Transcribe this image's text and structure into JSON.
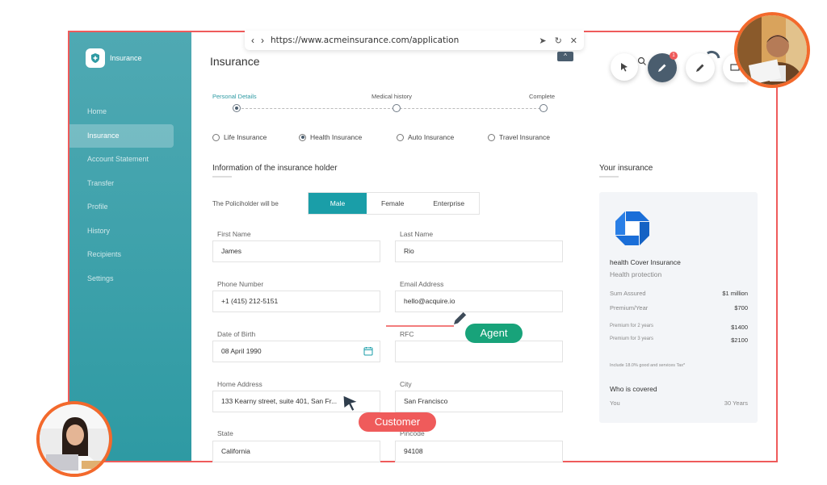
{
  "browser": {
    "back": "‹",
    "forward": "›",
    "url": "https://www.acmeinsurance.com/application",
    "actions": [
      "➤",
      "↻",
      "✕"
    ]
  },
  "sidebar": {
    "brand": "Insurance",
    "items": [
      "Home",
      "Insurance",
      "Account Statement",
      "Transfer",
      "Profile",
      "History",
      "Recipients",
      "Settings"
    ],
    "active_index": 1
  },
  "page": {
    "title": "Insurance",
    "collapse_icon": "^"
  },
  "stepper": {
    "steps": [
      "Personal Details",
      "Medical history",
      "Complete"
    ],
    "active_index": 0
  },
  "insurance_types": {
    "options": [
      "Life Insurance",
      "Health Insurance",
      "Auto Insurance",
      "Travel Insurance"
    ],
    "selected_index": 1
  },
  "holder": {
    "section_title": "Information of the insurance holder",
    "policyholder_label": "The Policiholder will be",
    "options": [
      "Male",
      "Female",
      "Enterprise"
    ],
    "selected_index": 0
  },
  "form": {
    "first_name": {
      "label": "First Name",
      "value": "James"
    },
    "last_name": {
      "label": "Last Name",
      "value": "Rio"
    },
    "phone": {
      "label": "Phone Number",
      "value": "+1 (415) 212-5151"
    },
    "email": {
      "label": "Email Address",
      "value": "hello@acquire.io"
    },
    "dob": {
      "label": "Date of Birth",
      "value": "08  April  1990"
    },
    "rfc": {
      "label": "RFC",
      "value": ""
    },
    "address": {
      "label": "Home Address",
      "value": "133 Kearny street, suite 401, San Fr..."
    },
    "city": {
      "label": "City",
      "value": "San Francisco"
    },
    "state": {
      "label": "State",
      "value": "California"
    },
    "pincode": {
      "label": "Pincode",
      "value": "94108"
    }
  },
  "your_insurance": {
    "section_title": "Your insurance",
    "plan_title": "health Cover Insurance",
    "plan_subtitle": "Health protection",
    "sum_assured_label": "Sum Assured",
    "sum_assured": "$1 million",
    "premium_label": "Premium/Year",
    "premium": "$700",
    "premium2_label": "Premium for 2 years",
    "premium2": "$1400",
    "premium3_label": "Premium for 3 years",
    "premium3": "$2100",
    "tax_note": "Include 18.0% good and services Tax*",
    "covered_title": "Who is covered",
    "covered_who": "You",
    "covered_age": "30 Years"
  },
  "toolbar": {
    "badge": "1"
  },
  "labels": {
    "agent": "Agent",
    "customer": "Customer"
  },
  "colors": {
    "accent": "#1a9ea8",
    "frame": "#ef5b5b",
    "agent": "#18a37a",
    "customer": "#ef5b5b",
    "avatar_ring": "#f3692c"
  }
}
